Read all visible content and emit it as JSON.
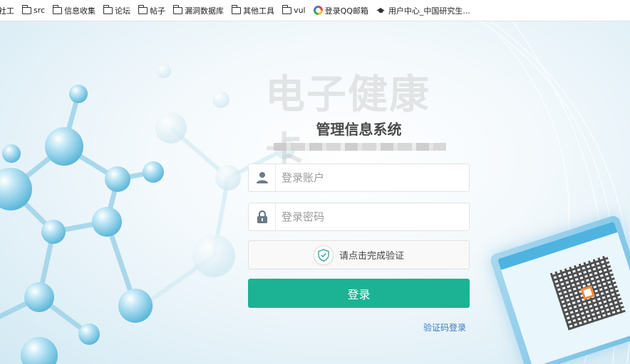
{
  "bookmarks": [
    {
      "label": "社工",
      "icon": "none"
    },
    {
      "label": "src",
      "icon": "folder-icon"
    },
    {
      "label": "信息收集",
      "icon": "folder-icon"
    },
    {
      "label": "论坛",
      "icon": "folder-icon"
    },
    {
      "label": "帖子",
      "icon": "folder-icon"
    },
    {
      "label": "漏洞数据库",
      "icon": "folder-icon"
    },
    {
      "label": "其他工具",
      "icon": "folder-icon"
    },
    {
      "label": "vul",
      "icon": "folder-icon"
    },
    {
      "label": "登录QQ邮箱",
      "icon": "qq-icon"
    },
    {
      "label": "用户中心_中国研究生...",
      "icon": "graduation-cap-icon"
    }
  ],
  "watermark": "电子健康卡",
  "login": {
    "system_title": "管理信息系统",
    "username_placeholder": "登录账户",
    "password_placeholder": "登录密码",
    "verify_label": "请点击完成验证",
    "submit_label": "登录",
    "code_login_link": "验证码登录"
  },
  "colors": {
    "primary": "#1bb394",
    "link": "#3b7bbf",
    "icon": "#6b7b88"
  }
}
